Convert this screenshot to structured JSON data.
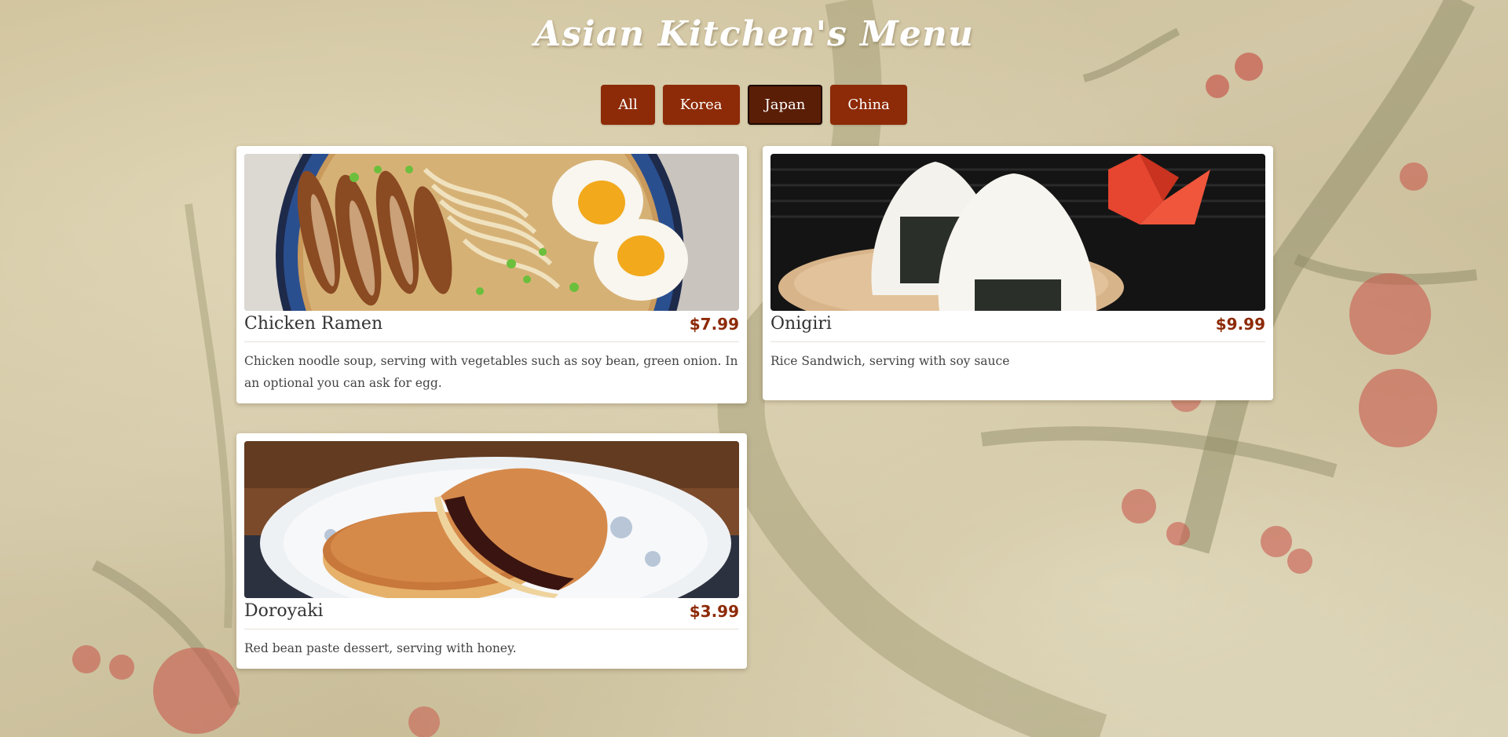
{
  "page": {
    "title": "Asian Kitchen's Menu"
  },
  "filters": [
    {
      "label": "All",
      "active": false
    },
    {
      "label": "Korea",
      "active": false
    },
    {
      "label": "Japan",
      "active": true
    },
    {
      "label": "China",
      "active": false
    }
  ],
  "menu": {
    "items": [
      {
        "name": "Chicken Ramen",
        "price": "$7.99",
        "description": "Chicken noodle soup, serving with vegetables such as soy bean, green onion. In an optional you can ask for egg.",
        "image_icon": "ramen-photo"
      },
      {
        "name": "Onigiri",
        "price": "$9.99",
        "description": "Rice Sandwich, serving with soy sauce",
        "image_icon": "onigiri-photo"
      },
      {
        "name": "Doroyaki",
        "price": "$3.99",
        "description": "Red bean paste dessert, serving with honey.",
        "image_icon": "dorayaki-photo"
      }
    ]
  },
  "colors": {
    "button": "#8d2a07",
    "button_active": "#5a1d05",
    "price": "#8d2a07"
  }
}
